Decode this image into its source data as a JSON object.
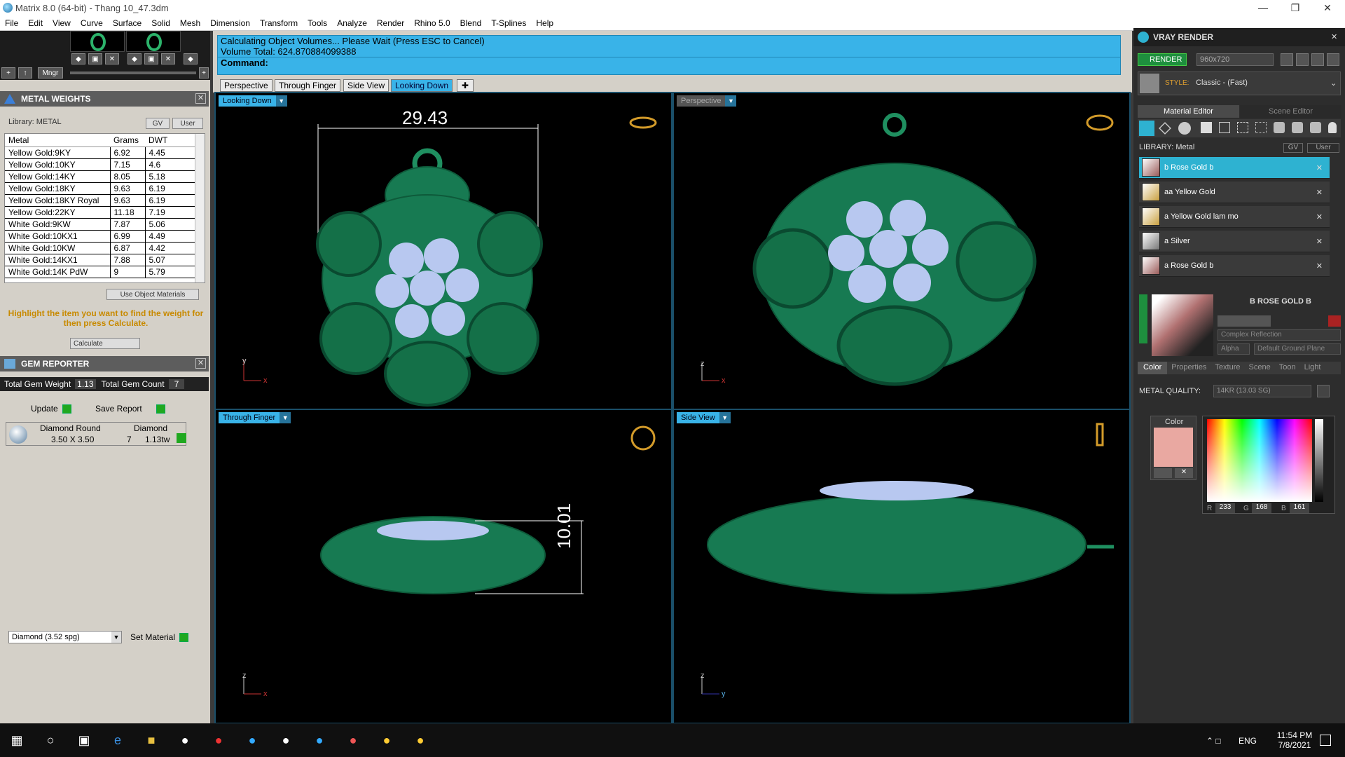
{
  "window": {
    "title": "Matrix 8.0 (64-bit) - Thang 10_47.3dm"
  },
  "menu": [
    "File",
    "Edit",
    "View",
    "Curve",
    "Surface",
    "Solid",
    "Mesh",
    "Dimension",
    "Transform",
    "Tools",
    "Analyze",
    "Render",
    "Rhino 5.0",
    "Blend",
    "T-Splines",
    "Help"
  ],
  "thumb_controls": {
    "mngr": "Mngr"
  },
  "metal_weights": {
    "title": "METAL WEIGHTS",
    "library": "Library: METAL",
    "gv": "GV",
    "user": "User",
    "columns": [
      "Metal",
      "Grams",
      "DWT"
    ],
    "rows": [
      [
        "Yellow Gold:9KY",
        "6.92",
        "4.45"
      ],
      [
        "Yellow Gold:10KY",
        "7.15",
        "4.6"
      ],
      [
        "Yellow Gold:14KY",
        "8.05",
        "5.18"
      ],
      [
        "Yellow Gold:18KY",
        "9.63",
        "6.19"
      ],
      [
        "Yellow Gold:18KY Royal",
        "9.63",
        "6.19"
      ],
      [
        "Yellow Gold:22KY",
        "11.18",
        "7.19"
      ],
      [
        "White Gold:9KW",
        "7.87",
        "5.06"
      ],
      [
        "White Gold:10KX1",
        "6.99",
        "4.49"
      ],
      [
        "White Gold:10KW",
        "6.87",
        "4.42"
      ],
      [
        "White Gold:14KX1",
        "7.88",
        "5.07"
      ],
      [
        "White Gold:14K PdW",
        "9",
        "5.79"
      ]
    ],
    "use_object_materials": "Use Object Materials",
    "hint": "Highlight the item you want to find the weight for then press Calculate.",
    "calculate": "Calculate"
  },
  "gem_reporter": {
    "title": "GEM REPORTER",
    "total_weight_label": "Total Gem Weight",
    "total_weight_value": "1.13",
    "total_count_label": "Total Gem Count",
    "total_count_value": "7",
    "update": "Update",
    "save_report": "Save Report",
    "gem": {
      "name": "Diamond Round",
      "type": "Diamond",
      "size": "3.50 X 3.50",
      "count": "7",
      "weight": "1.13tw"
    },
    "material_select": "Diamond    (3.52 spg)",
    "set_material": "Set Material"
  },
  "command": {
    "line1": "Calculating Object Volumes... Please Wait (Press ESC to Cancel)",
    "line2": "Volume Total: 624.870884099388",
    "prompt": "Command:"
  },
  "viewport_tabs": [
    "Perspective",
    "Through Finger",
    "Side View",
    "Looking Down"
  ],
  "viewports": {
    "looking_down": {
      "label": "Looking Down",
      "dimension": "29.43",
      "ax1": "y",
      "ax2": "x"
    },
    "perspective": {
      "label": "Perspective",
      "ax1": "z",
      "ax2": "x"
    },
    "through_finger": {
      "label": "Through Finger",
      "dimension": "10.01",
      "ax1": "z",
      "ax2": "x"
    },
    "side_view": {
      "label": "Side View",
      "ax1": "z",
      "ax2": "y"
    }
  },
  "vray": {
    "title": "VRAY RENDER",
    "render": "RENDER",
    "resolution": "960x720",
    "style_label": "STYLE:",
    "style_value": "Classic - (Fast)",
    "tab_material": "Material Editor",
    "tab_scene": "Scene Editor",
    "library": "LIBRARY: Metal",
    "gv": "GV",
    "user": "User",
    "materials": [
      "b Rose Gold b",
      "aa Yellow Gold",
      "a Yellow Gold lam mo",
      "a Silver",
      "a Rose Gold b"
    ],
    "preview_name": "B ROSE GOLD B",
    "reflection": "Complex Reflection",
    "alpha": "Alpha",
    "ground": "Default Ground Plane",
    "subtabs": [
      "Color",
      "Properties",
      "Texture",
      "Scene",
      "Toon",
      "Light"
    ],
    "metal_quality_label": "METAL QUALITY:",
    "metal_quality_value": "14KR          (13.03 SG)",
    "color_label": "Color",
    "r_label": "R",
    "r": "233",
    "g_label": "G",
    "g": "168",
    "b_label": "B",
    "b": "161",
    "swatch_color": "#e9a8a1"
  },
  "taskbar": {
    "time": "11:54 PM",
    "date": "7/8/2021",
    "lang": "ENG"
  }
}
